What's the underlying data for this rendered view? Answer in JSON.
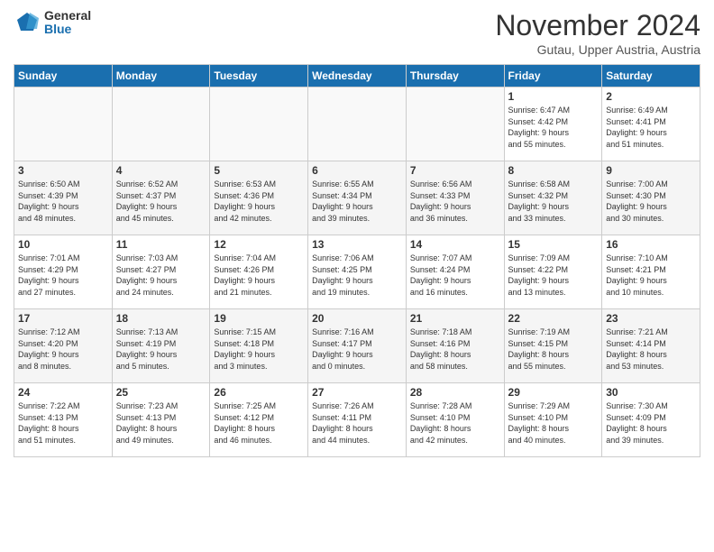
{
  "logo": {
    "general": "General",
    "blue": "Blue"
  },
  "title": "November 2024",
  "location": "Gutau, Upper Austria, Austria",
  "headers": [
    "Sunday",
    "Monday",
    "Tuesday",
    "Wednesday",
    "Thursday",
    "Friday",
    "Saturday"
  ],
  "weeks": [
    [
      {
        "day": "",
        "info": ""
      },
      {
        "day": "",
        "info": ""
      },
      {
        "day": "",
        "info": ""
      },
      {
        "day": "",
        "info": ""
      },
      {
        "day": "",
        "info": ""
      },
      {
        "day": "1",
        "info": "Sunrise: 6:47 AM\nSunset: 4:42 PM\nDaylight: 9 hours\nand 55 minutes."
      },
      {
        "day": "2",
        "info": "Sunrise: 6:49 AM\nSunset: 4:41 PM\nDaylight: 9 hours\nand 51 minutes."
      }
    ],
    [
      {
        "day": "3",
        "info": "Sunrise: 6:50 AM\nSunset: 4:39 PM\nDaylight: 9 hours\nand 48 minutes."
      },
      {
        "day": "4",
        "info": "Sunrise: 6:52 AM\nSunset: 4:37 PM\nDaylight: 9 hours\nand 45 minutes."
      },
      {
        "day": "5",
        "info": "Sunrise: 6:53 AM\nSunset: 4:36 PM\nDaylight: 9 hours\nand 42 minutes."
      },
      {
        "day": "6",
        "info": "Sunrise: 6:55 AM\nSunset: 4:34 PM\nDaylight: 9 hours\nand 39 minutes."
      },
      {
        "day": "7",
        "info": "Sunrise: 6:56 AM\nSunset: 4:33 PM\nDaylight: 9 hours\nand 36 minutes."
      },
      {
        "day": "8",
        "info": "Sunrise: 6:58 AM\nSunset: 4:32 PM\nDaylight: 9 hours\nand 33 minutes."
      },
      {
        "day": "9",
        "info": "Sunrise: 7:00 AM\nSunset: 4:30 PM\nDaylight: 9 hours\nand 30 minutes."
      }
    ],
    [
      {
        "day": "10",
        "info": "Sunrise: 7:01 AM\nSunset: 4:29 PM\nDaylight: 9 hours\nand 27 minutes."
      },
      {
        "day": "11",
        "info": "Sunrise: 7:03 AM\nSunset: 4:27 PM\nDaylight: 9 hours\nand 24 minutes."
      },
      {
        "day": "12",
        "info": "Sunrise: 7:04 AM\nSunset: 4:26 PM\nDaylight: 9 hours\nand 21 minutes."
      },
      {
        "day": "13",
        "info": "Sunrise: 7:06 AM\nSunset: 4:25 PM\nDaylight: 9 hours\nand 19 minutes."
      },
      {
        "day": "14",
        "info": "Sunrise: 7:07 AM\nSunset: 4:24 PM\nDaylight: 9 hours\nand 16 minutes."
      },
      {
        "day": "15",
        "info": "Sunrise: 7:09 AM\nSunset: 4:22 PM\nDaylight: 9 hours\nand 13 minutes."
      },
      {
        "day": "16",
        "info": "Sunrise: 7:10 AM\nSunset: 4:21 PM\nDaylight: 9 hours\nand 10 minutes."
      }
    ],
    [
      {
        "day": "17",
        "info": "Sunrise: 7:12 AM\nSunset: 4:20 PM\nDaylight: 9 hours\nand 8 minutes."
      },
      {
        "day": "18",
        "info": "Sunrise: 7:13 AM\nSunset: 4:19 PM\nDaylight: 9 hours\nand 5 minutes."
      },
      {
        "day": "19",
        "info": "Sunrise: 7:15 AM\nSunset: 4:18 PM\nDaylight: 9 hours\nand 3 minutes."
      },
      {
        "day": "20",
        "info": "Sunrise: 7:16 AM\nSunset: 4:17 PM\nDaylight: 9 hours\nand 0 minutes."
      },
      {
        "day": "21",
        "info": "Sunrise: 7:18 AM\nSunset: 4:16 PM\nDaylight: 8 hours\nand 58 minutes."
      },
      {
        "day": "22",
        "info": "Sunrise: 7:19 AM\nSunset: 4:15 PM\nDaylight: 8 hours\nand 55 minutes."
      },
      {
        "day": "23",
        "info": "Sunrise: 7:21 AM\nSunset: 4:14 PM\nDaylight: 8 hours\nand 53 minutes."
      }
    ],
    [
      {
        "day": "24",
        "info": "Sunrise: 7:22 AM\nSunset: 4:13 PM\nDaylight: 8 hours\nand 51 minutes."
      },
      {
        "day": "25",
        "info": "Sunrise: 7:23 AM\nSunset: 4:13 PM\nDaylight: 8 hours\nand 49 minutes."
      },
      {
        "day": "26",
        "info": "Sunrise: 7:25 AM\nSunset: 4:12 PM\nDaylight: 8 hours\nand 46 minutes."
      },
      {
        "day": "27",
        "info": "Sunrise: 7:26 AM\nSunset: 4:11 PM\nDaylight: 8 hours\nand 44 minutes."
      },
      {
        "day": "28",
        "info": "Sunrise: 7:28 AM\nSunset: 4:10 PM\nDaylight: 8 hours\nand 42 minutes."
      },
      {
        "day": "29",
        "info": "Sunrise: 7:29 AM\nSunset: 4:10 PM\nDaylight: 8 hours\nand 40 minutes."
      },
      {
        "day": "30",
        "info": "Sunrise: 7:30 AM\nSunset: 4:09 PM\nDaylight: 8 hours\nand 39 minutes."
      }
    ]
  ]
}
